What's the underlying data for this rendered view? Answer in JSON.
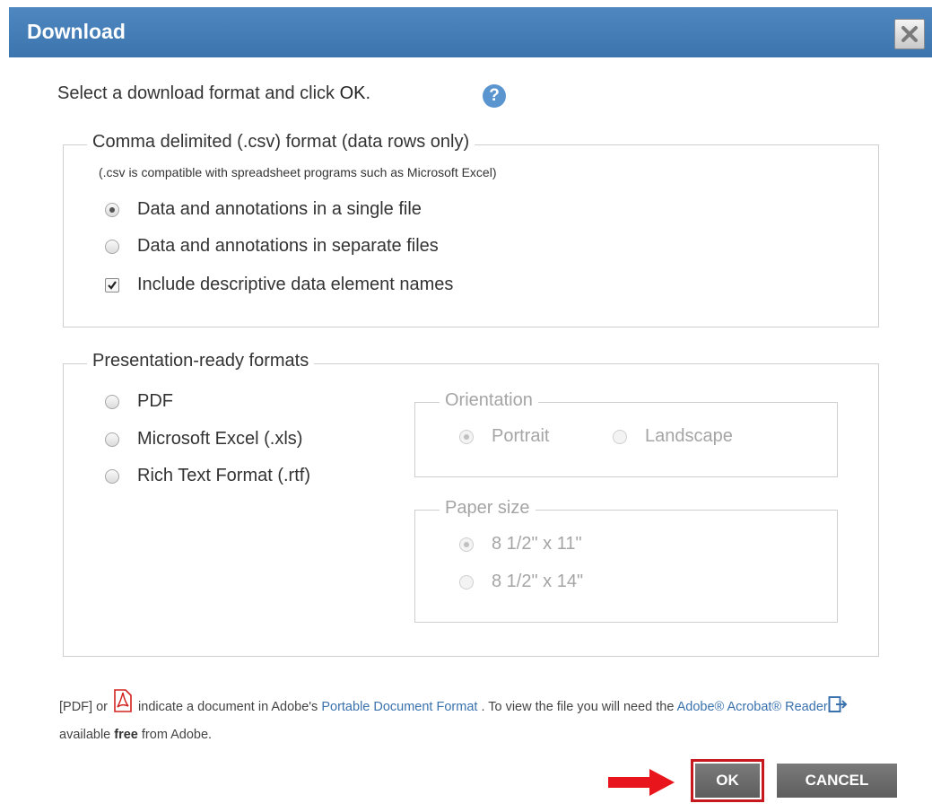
{
  "dialog": {
    "title": "Download"
  },
  "intro": {
    "text_before": "Select a download format and click ",
    "ok_word": "OK",
    "text_after": ".",
    "help_icon": "?"
  },
  "csv_group": {
    "legend": "Comma delimited (.csv) format (data rows only)",
    "note": "(.csv is compatible with spreadsheet programs such as Microsoft Excel)",
    "options": [
      {
        "label": "Data and annotations in a single file",
        "selected": true
      },
      {
        "label": "Data and annotations in separate files",
        "selected": false
      }
    ],
    "checkbox": {
      "label": "Include descriptive data element names",
      "checked": true
    }
  },
  "presentation_group": {
    "legend": "Presentation-ready formats",
    "options": [
      {
        "label": "PDF",
        "selected": false
      },
      {
        "label": "Microsoft Excel (.xls)",
        "selected": false
      },
      {
        "label": "Rich Text Format (.rtf)",
        "selected": false
      }
    ],
    "orientation": {
      "legend": "Orientation",
      "options": [
        {
          "label": "Portrait",
          "selected": true
        },
        {
          "label": "Landscape",
          "selected": false
        }
      ]
    },
    "paper": {
      "legend": "Paper size",
      "options": [
        {
          "label": "8 1/2\" x 11\"",
          "selected": true
        },
        {
          "label": "8 1/2\" x 14\"",
          "selected": false
        }
      ]
    }
  },
  "footer": {
    "part1": "[PDF] or ",
    "part2": " indicate a document in Adobe's ",
    "link1": "Portable Document Format",
    "part3": " . To view the file you will need the ",
    "link2": "Adobe® Acrobat® Reader",
    "part4": " available ",
    "bold_word": "free",
    "part5": " from Adobe."
  },
  "buttons": {
    "ok": "OK",
    "cancel": "CANCEL"
  },
  "colors": {
    "header": "#4078b3",
    "ok_highlight": "#c8181f",
    "arrow": "#e8161c",
    "link": "#3a72ad"
  }
}
